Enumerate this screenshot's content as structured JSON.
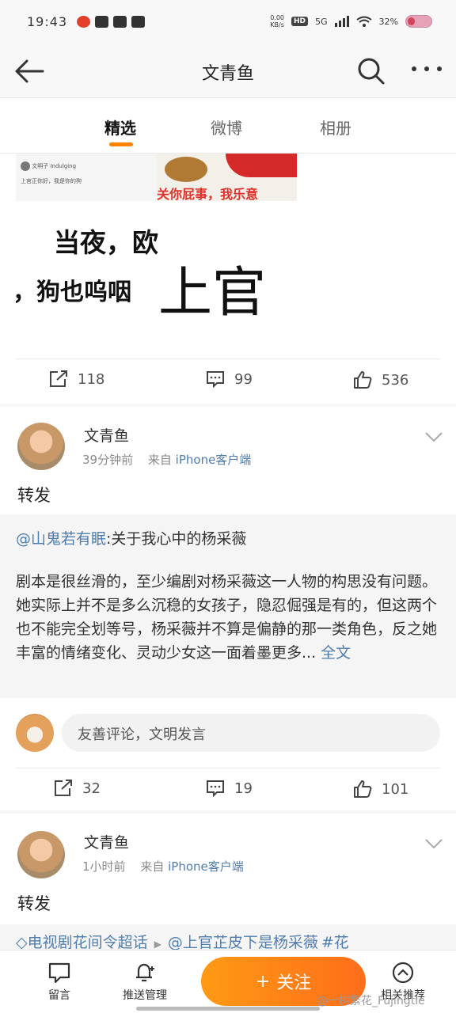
{
  "status_bar": {
    "time": "19:43",
    "net_speed": "0.00",
    "net_unit": "KB/s",
    "hd": "HD",
    "signal": "5G",
    "battery": "32%"
  },
  "nav": {
    "title": "文青鱼"
  },
  "tabs": [
    {
      "label": "精选",
      "active": true
    },
    {
      "label": "微博",
      "active": false
    },
    {
      "label": "相册",
      "active": false
    }
  ],
  "post1": {
    "media": {
      "thumb_name": "文明子 Indulging",
      "thumb_text": "上官正你好，我是你的狗",
      "meme_caption": "关你屁事，我乐意",
      "big_text_1": "当夜，欧",
      "big_text_2": "，狗也呜咽",
      "big_text_3": "上官 "
    },
    "actions": {
      "reposts": "118",
      "comments": "99",
      "likes": "536"
    }
  },
  "post2": {
    "username": "文青鱼",
    "time": "39分钟前",
    "source_prefix": "来自",
    "source": "iPhone客户端",
    "text": "转发",
    "quoted": {
      "mention": "@山鬼若有眠",
      "title": ":关于我心中的杨采薇",
      "body": "剧本是很丝滑的，至少编剧对杨采薇这一人物的构思没有问题。她实际上并不是多么沉稳的女孩子，隐忍倔强是有的，但这两个也不能完全划等号，杨采薇并不算是偏静的那一类角色，反之她丰富的情绪变化、灵动少女这一面着墨更多...",
      "more": "全文"
    },
    "comment_placeholder": "友善评论，文明发言",
    "actions": {
      "reposts": "32",
      "comments": "19",
      "likes": "101"
    }
  },
  "post3": {
    "username": "文青鱼",
    "time": "1小时前",
    "source_prefix": "来自",
    "source": "iPhone客户端",
    "text": "转发",
    "topics": [
      "电视剧花间令超话",
      "@上官芷皮下是杨采薇",
      "#花"
    ]
  },
  "bottom_bar": {
    "message": "留言",
    "push": "推送管理",
    "follow": "关注",
    "related": "相关推荐"
  },
  "watermark": "@一树繁花_Fujingtie",
  "colors": {
    "accent": "#ff8200",
    "link": "#507daf"
  }
}
